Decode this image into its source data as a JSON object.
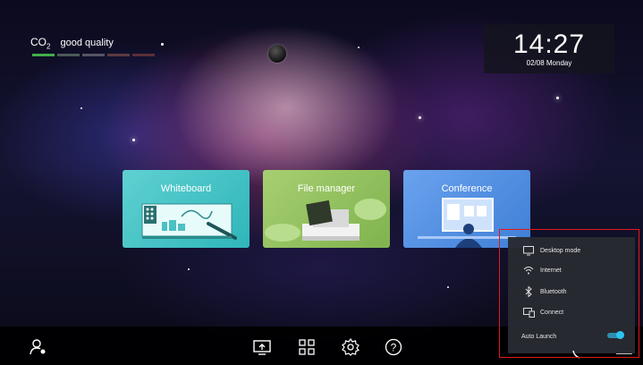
{
  "co2": {
    "prefix": "CO",
    "sub": "2",
    "status": "good quality",
    "levels": [
      "#3fb04a",
      "#4a5a58",
      "#555564",
      "#5a3a40",
      "#5c2f38"
    ]
  },
  "clock": {
    "time": "14:27",
    "date": "02/08 Monday"
  },
  "tiles": [
    {
      "label": "Whiteboard"
    },
    {
      "label": "File manager"
    },
    {
      "label": "Conference"
    }
  ],
  "taskbar": {
    "icons": [
      "user-settings-icon",
      "screen-share-icon",
      "apps-grid-icon",
      "settings-icon",
      "help-icon"
    ]
  },
  "popup": {
    "items": [
      {
        "label": "Desktop mode",
        "icon": "monitor-icon"
      },
      {
        "label": "Internet",
        "icon": "wifi-icon"
      },
      {
        "label": "Bluetooth",
        "icon": "bluetooth-icon"
      },
      {
        "label": "Connect",
        "icon": "connect-icon"
      }
    ],
    "auto_launch": {
      "label": "Auto Launch",
      "enabled": true
    }
  },
  "colors": {
    "highlight": "#e01a1a",
    "toggle": "#2bc6f0"
  }
}
